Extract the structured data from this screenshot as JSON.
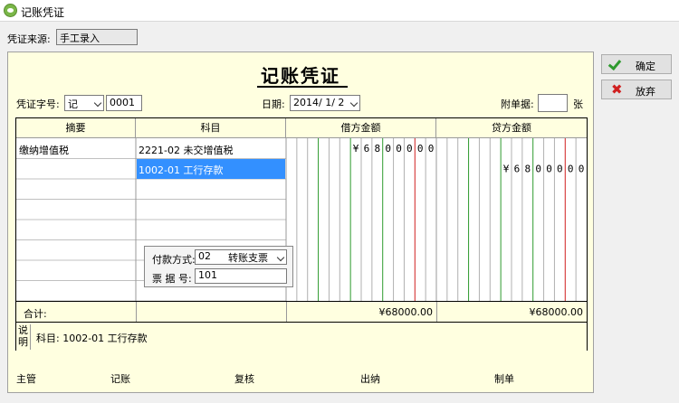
{
  "window": {
    "title": "记账凭证"
  },
  "source": {
    "label": "凭证来源:",
    "value": "手工录入"
  },
  "voucher": {
    "title": "记账凭证",
    "word_label": "凭证字号:",
    "word": "记",
    "number": "0001",
    "date_label": "日期:",
    "date": "2014/ 1/ 2",
    "attach_label": "附单据:",
    "attach_value": "",
    "attach_unit": "张"
  },
  "table": {
    "headers": {
      "summary": "摘要",
      "subject": "科目",
      "debit": "借方金额",
      "credit": "贷方金额"
    },
    "rows": [
      {
        "summary": "缴纳增值税",
        "subject": "2221-02 未交增值税",
        "debit_digits": [
          "¥",
          "6",
          "8",
          "0",
          "0",
          "0",
          "0",
          "0"
        ],
        "credit_digits": []
      },
      {
        "summary": "",
        "subject": "1002-01 工行存款",
        "debit_digits": [],
        "credit_digits": [
          "¥",
          "6",
          "8",
          "0",
          "0",
          "0",
          "0",
          "0"
        ]
      }
    ],
    "popup": {
      "pay_label": "付款方式:",
      "pay_value": "02",
      "pay_name": "转账支票",
      "ticket_label": "票 据 号:",
      "ticket_value": "101"
    },
    "total_label": "合计:",
    "debit_total": "¥68000.00",
    "credit_total": "¥68000.00",
    "note_label": "说明",
    "note": "科目: 1002-01 工行存款"
  },
  "signatures": [
    "主管",
    "记账",
    "复核",
    "出纳",
    "制单"
  ],
  "buttons": {
    "ok": "确定",
    "discard": "放弃"
  },
  "colors": {
    "panel": "#ffffe0",
    "green_line": "#2e9a2e",
    "red_line": "#d02020",
    "selection": "#3390ff"
  }
}
